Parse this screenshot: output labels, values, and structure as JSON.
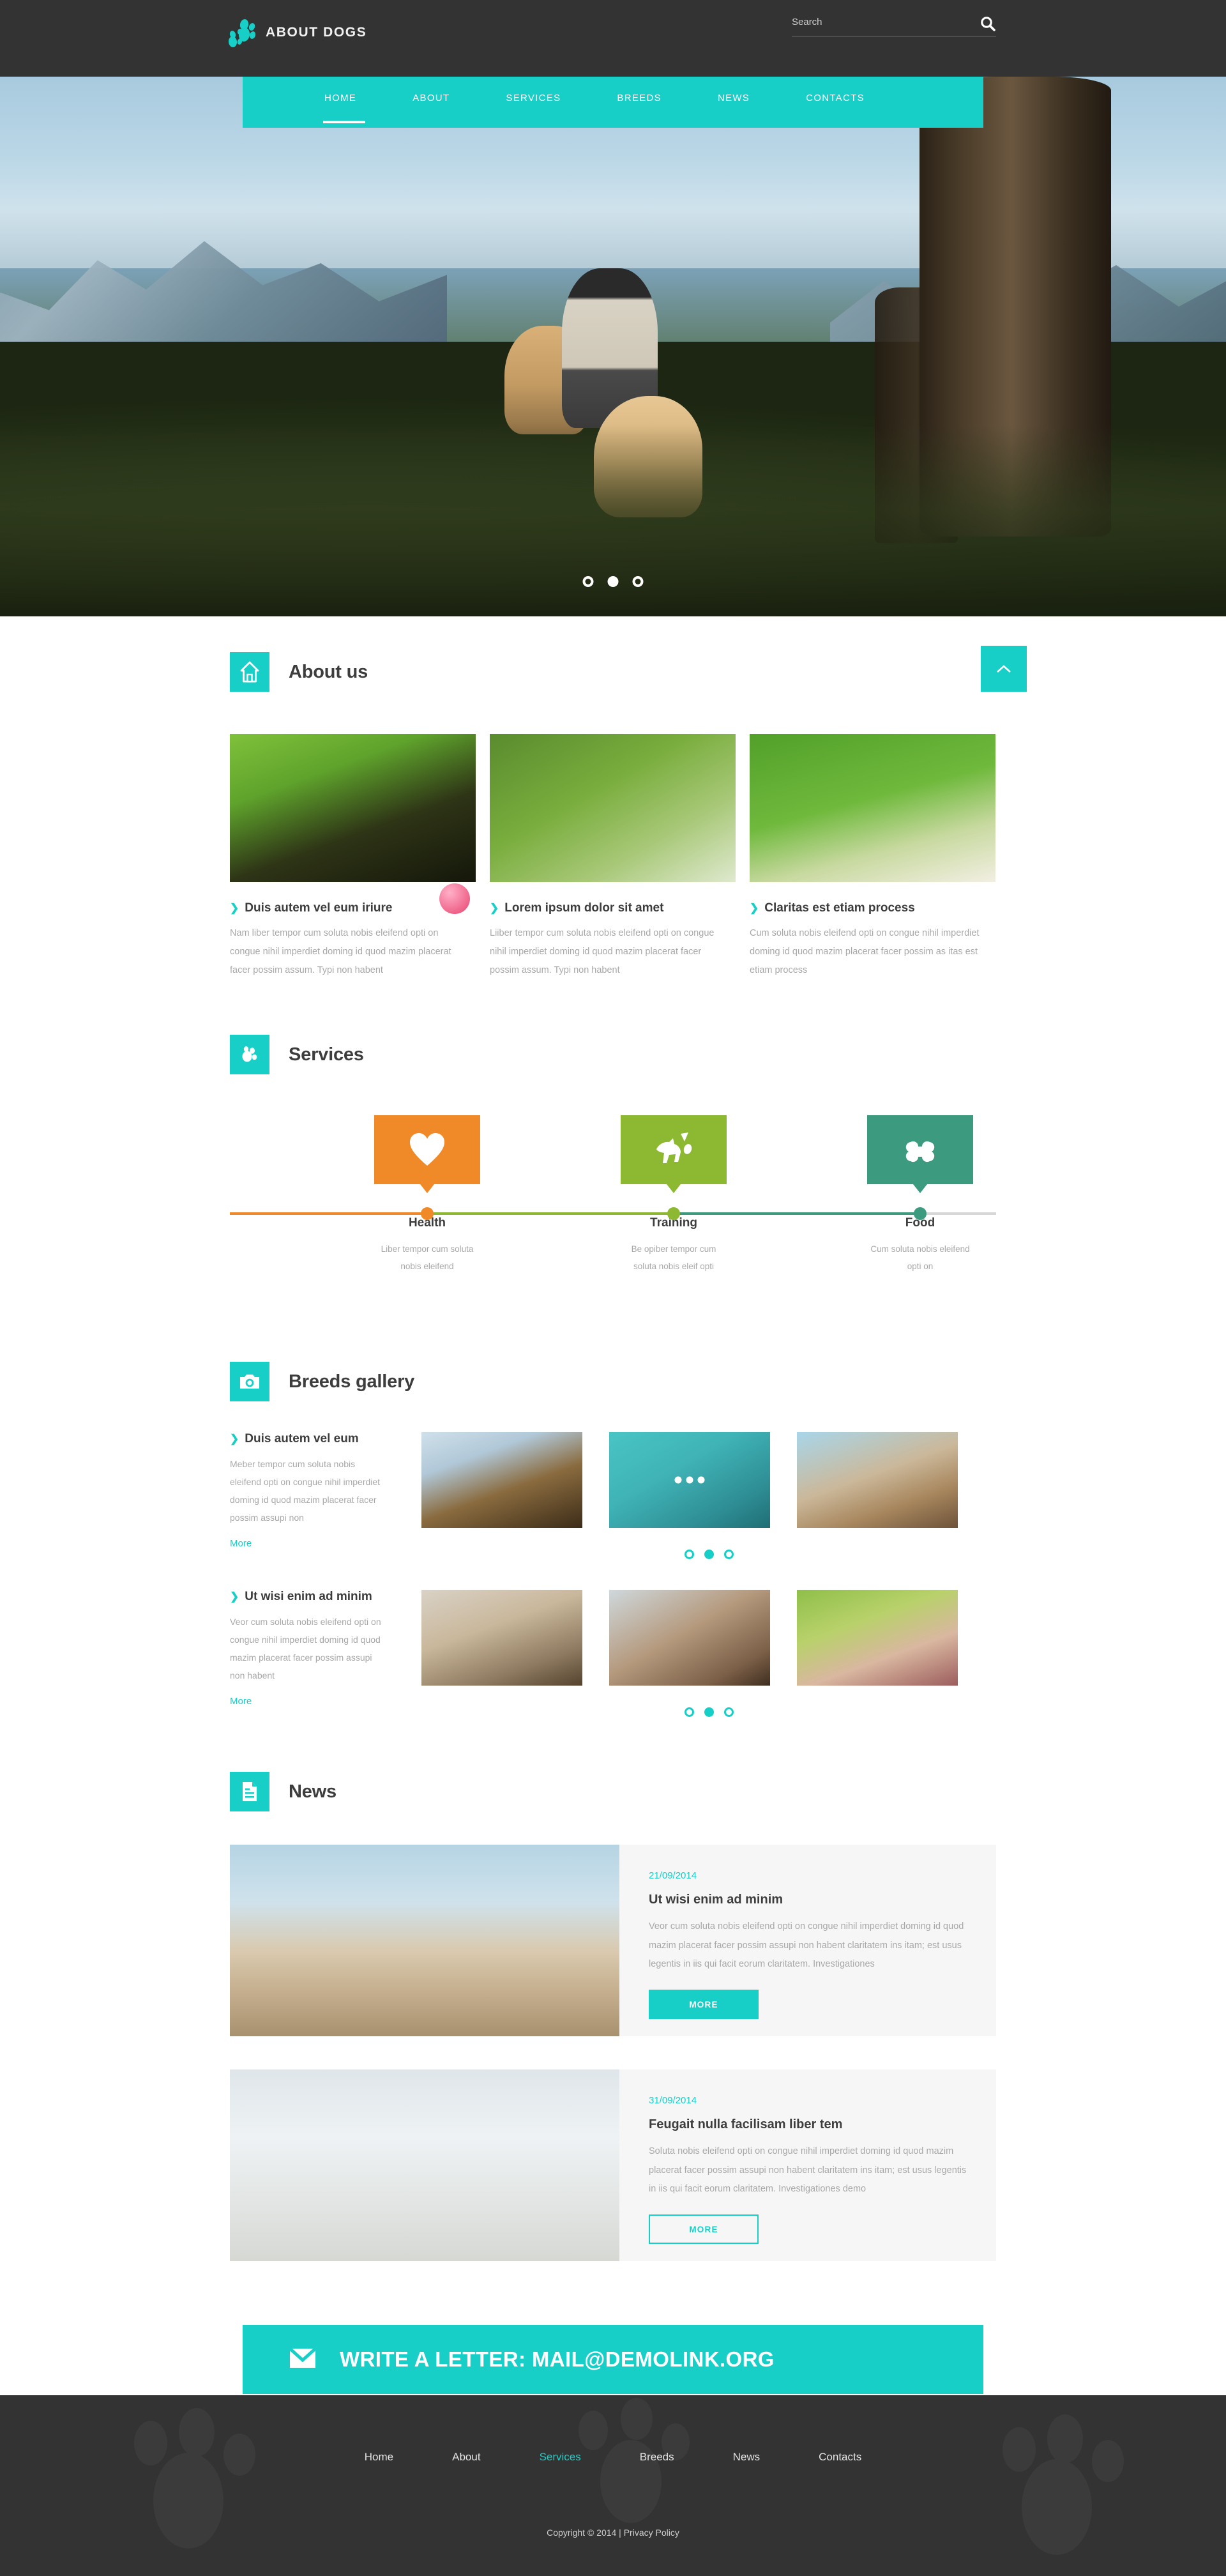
{
  "site": {
    "logo_text": "ABOUT DOGS",
    "logo_icon": "paw-icon"
  },
  "search": {
    "placeholder": "Search",
    "value": "",
    "icon": "search-icon"
  },
  "nav": {
    "items": [
      {
        "label": "HOME",
        "active": true
      },
      {
        "label": "ABOUT",
        "active": false
      },
      {
        "label": "SERVICES",
        "active": false
      },
      {
        "label": "BREEDS",
        "active": false
      },
      {
        "label": "NEWS",
        "active": false
      },
      {
        "label": "CONTACTS",
        "active": false
      }
    ]
  },
  "hero": {
    "slider_dots": [
      {
        "active": false
      },
      {
        "active": true
      },
      {
        "active": false
      }
    ]
  },
  "scroll_top": {
    "icon": "chevron-up-icon"
  },
  "about": {
    "title": "About us",
    "icon": "home-icon",
    "cards": [
      {
        "heading": "Duis autem vel eum iriure",
        "text": "Nam liber tempor cum soluta nobis eleifend opti on congue nihil imperdiet doming id quod mazim placerat facer possim assum. Typi non habent"
      },
      {
        "heading": "Lorem ipsum dolor sit amet",
        "text": "Liiber tempor cum soluta nobis eleifend opti on congue nihil imperdiet doming id quod mazim placerat facer possim assum. Typi non habent"
      },
      {
        "heading": "Claritas est etiam process",
        "text": "Cum soluta nobis eleifend opti on congue nihil imperdiet doming id quod mazim placerat facer possim as itas est etiam process"
      }
    ]
  },
  "services": {
    "title": "Services",
    "icon": "paw-icon",
    "items": [
      {
        "name": "Health",
        "desc": "Liber tempor cum soluta nobis eleifend",
        "color": "#f08a28",
        "icon": "heart-icon"
      },
      {
        "name": "Training",
        "desc": "Be opiber tempor cum soluta nobis eleif opti",
        "color": "#8cb832",
        "icon": "running-dog-icon"
      },
      {
        "name": "Food",
        "desc": "Cum soluta nobis eleifend opti on",
        "color": "#3c9b7e",
        "icon": "bone-icon"
      }
    ],
    "track_color": "#d7d7d7"
  },
  "breeds": {
    "title": "Breeds gallery",
    "icon": "camera-icon",
    "rows": [
      {
        "heading": "Duis autem vel eum",
        "text": "Meber tempor cum soluta nobis eleifend opti on congue nihil imperdiet doming id quod mazim placerat facer possim assupi non",
        "more_label": "More",
        "thumbs": [
          {
            "name": "german-shepherd-portrait",
            "has_dots": false
          },
          {
            "name": "dog-swimming-in-pool",
            "has_dots": true
          },
          {
            "name": "couple-with-dog-on-beach",
            "has_dots": false
          }
        ],
        "dots": [
          {
            "active": false
          },
          {
            "active": true
          },
          {
            "active": false
          }
        ]
      },
      {
        "heading": "Ut wisi enim ad minim",
        "text": "Veor cum soluta nobis eleifend opti on congue nihil imperdiet doming id quod mazim placerat facer possim assupi non habent",
        "more_label": "More",
        "thumbs": [
          {
            "name": "woman-hugging-white-dog",
            "has_dots": false
          },
          {
            "name": "man-kissing-dog",
            "has_dots": false
          },
          {
            "name": "woman-with-puppy-in-flowers",
            "has_dots": false
          }
        ],
        "dots": [
          {
            "active": false
          },
          {
            "active": true
          },
          {
            "active": false
          }
        ]
      }
    ]
  },
  "news": {
    "title": "News",
    "icon": "document-icon",
    "items": [
      {
        "date": "21/09/2014",
        "title": "Ut wisi enim ad minim",
        "text": "Veor cum soluta nobis eleifend opti on congue nihil imperdiet doming id quod mazim placerat facer possim assupi non habent claritatem ins itam; est usus legentis in iis qui facit eorum claritatem. Investigationes",
        "button_label": "MORE",
        "button_style": "solid",
        "image_name": "family-on-beach-with-dog"
      },
      {
        "date": "31/09/2014",
        "title": "Feugait nulla facilisam liber tem",
        "text": "Soluta nobis eleifend opti on congue nihil imperdiet doming id quod mazim placerat facer possim assupi non habent claritatem ins itam; est usus legentis in iis qui facit eorum claritatem. Investigationes demo",
        "button_label": "MORE",
        "button_style": "ghost",
        "image_name": "white-dog-in-snow"
      }
    ]
  },
  "letter_bar": {
    "label": "WRITE A LETTER: MAIL@DEMOLINK.ORG",
    "icon": "envelope-icon"
  },
  "footer": {
    "nav": [
      {
        "label": "Home",
        "active": false
      },
      {
        "label": "About",
        "active": false
      },
      {
        "label": "Services",
        "active": true
      },
      {
        "label": "Breeds",
        "active": false
      },
      {
        "label": "News",
        "active": false
      },
      {
        "label": "Contacts",
        "active": false
      }
    ],
    "copyright": "Copyright © 2014 |",
    "privacy": "Privacy Policy"
  },
  "colors": {
    "accent": "#17cfc6",
    "dark": "#333333",
    "orange": "#f08a28",
    "green": "#8cb832",
    "teal_green": "#3c9b7e",
    "muted_text": "#a8a8a8"
  }
}
